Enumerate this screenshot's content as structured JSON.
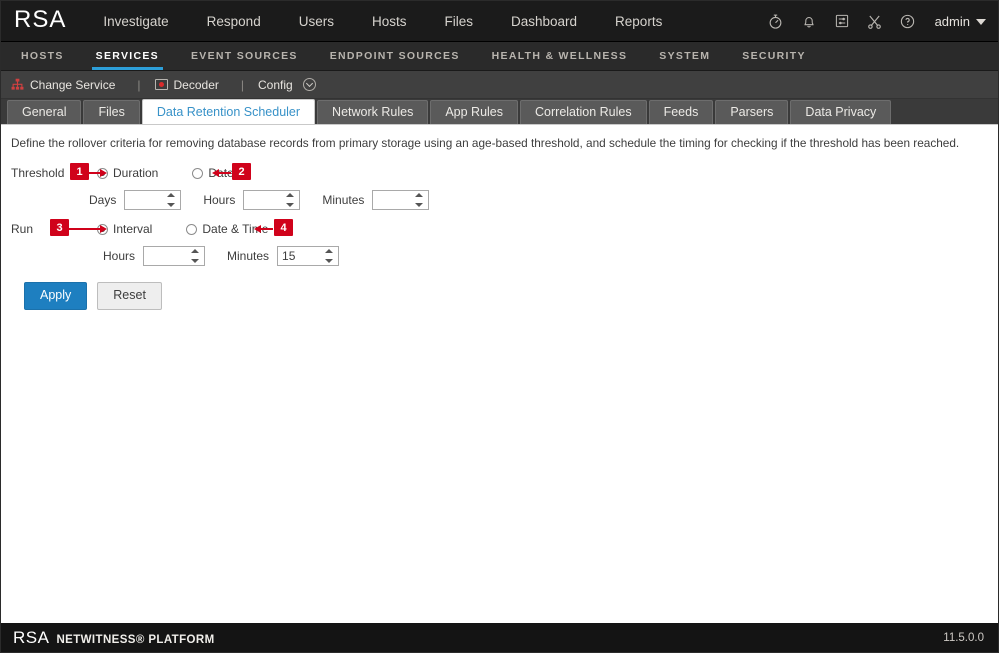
{
  "header": {
    "brand": "RSA",
    "nav": [
      {
        "label": "Investigate",
        "name": "nav-investigate"
      },
      {
        "label": "Respond",
        "name": "nav-respond"
      },
      {
        "label": "Users",
        "name": "nav-users"
      },
      {
        "label": "Hosts",
        "name": "nav-hosts"
      },
      {
        "label": "Files",
        "name": "nav-files"
      },
      {
        "label": "Dashboard",
        "name": "nav-dashboard"
      },
      {
        "label": "Reports",
        "name": "nav-reports"
      }
    ],
    "icons": [
      {
        "name": "timer-icon",
        "glyph": "stopwatch"
      },
      {
        "name": "notifications-bell-icon",
        "glyph": "bell"
      },
      {
        "name": "tasks-config-icon",
        "glyph": "sliders-box"
      },
      {
        "name": "tools-icon",
        "glyph": "shears"
      },
      {
        "name": "help-icon",
        "glyph": "question-circle"
      }
    ],
    "user": "admin"
  },
  "subnav": {
    "items": [
      {
        "label": "HOSTS",
        "active": false
      },
      {
        "label": "SERVICES",
        "active": true
      },
      {
        "label": "EVENT SOURCES",
        "active": false
      },
      {
        "label": "ENDPOINT SOURCES",
        "active": false
      },
      {
        "label": "HEALTH & WELLNESS",
        "active": false
      },
      {
        "label": "SYSTEM",
        "active": false
      },
      {
        "label": "SECURITY",
        "active": false
      }
    ],
    "accent": "#2d9fd9"
  },
  "breadcrumb": {
    "change_service": "Change Service",
    "separator": "|",
    "service": "Decoder",
    "config": "Config"
  },
  "tabs": [
    {
      "label": "General",
      "active": false
    },
    {
      "label": "Files",
      "active": false
    },
    {
      "label": "Data Retention Scheduler",
      "active": true
    },
    {
      "label": "Network Rules",
      "active": false
    },
    {
      "label": "App Rules",
      "active": false
    },
    {
      "label": "Correlation Rules",
      "active": false
    },
    {
      "label": "Feeds",
      "active": false
    },
    {
      "label": "Parsers",
      "active": false
    },
    {
      "label": "Data Privacy",
      "active": false
    }
  ],
  "panel": {
    "description": "Define the rollover criteria for removing database records from primary storage using an age-based threshold, and schedule the timing for checking if the threshold has been reached.",
    "threshold": {
      "label": "Threshold",
      "options": [
        {
          "label": "Duration",
          "selected": true
        },
        {
          "label": "Date",
          "selected": false
        }
      ],
      "fields": [
        {
          "label": "Days",
          "value": "",
          "placeholder": ""
        },
        {
          "label": "Hours",
          "value": "",
          "placeholder": ""
        },
        {
          "label": "Minutes",
          "value": "",
          "placeholder": ""
        }
      ]
    },
    "run": {
      "label": "Run",
      "options": [
        {
          "label": "Interval",
          "selected": true
        },
        {
          "label": "Date & Time",
          "selected": false
        }
      ],
      "fields": [
        {
          "label": "Hours",
          "value": "",
          "placeholder": ""
        },
        {
          "label": "Minutes",
          "value": "15",
          "placeholder": ""
        }
      ]
    },
    "buttons": {
      "apply": "Apply",
      "reset": "Reset"
    }
  },
  "annotations": [
    {
      "id": "1",
      "label": "1",
      "target": "duration-radio"
    },
    {
      "id": "2",
      "label": "2",
      "target": "date-radio"
    },
    {
      "id": "3",
      "label": "3",
      "target": "interval-radio"
    },
    {
      "id": "4",
      "label": "4",
      "target": "date-time-radio"
    }
  ],
  "footer": {
    "brand": "RSA",
    "product": "NETWITNESS® PLATFORM",
    "version": "11.5.0.0"
  },
  "colors": {
    "accent_blue": "#2d9fd9",
    "primary_button": "#1e7fc0",
    "annotation_red": "#d0021b",
    "active_tab_text": "#3892c8"
  }
}
